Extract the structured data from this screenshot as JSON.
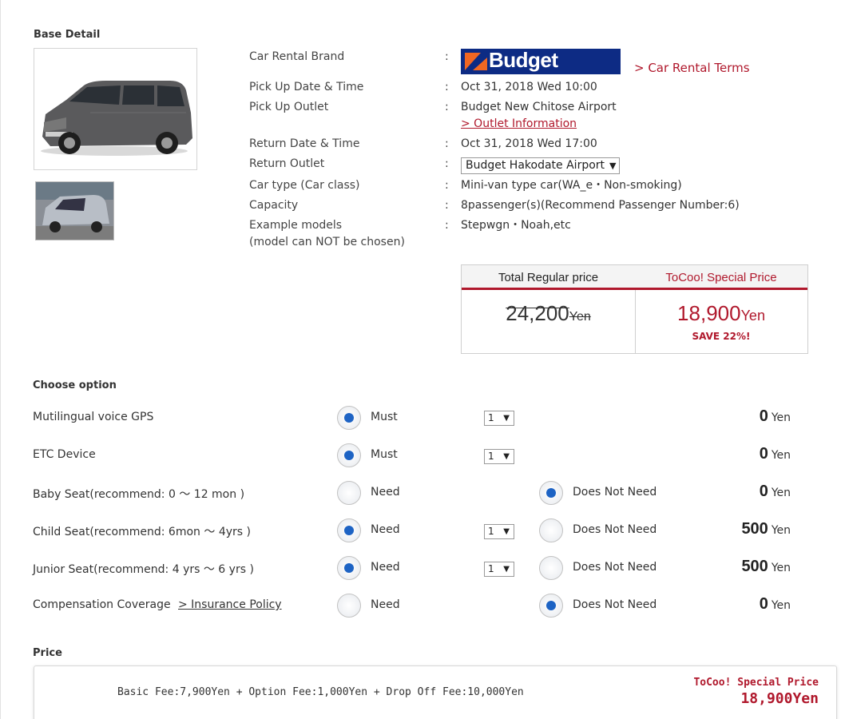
{
  "base_detail": {
    "title": "Base Detail",
    "rows": {
      "brand": {
        "label": "Car Rental Brand",
        "logo_text": "Budget",
        "terms_link": "> Car Rental Terms"
      },
      "pickup_datetime": {
        "label": "Pick Up Date & Time",
        "value": "Oct 31, 2018 Wed 10:00"
      },
      "pickup_outlet": {
        "label": "Pick Up Outlet",
        "value": "Budget New Chitose Airport",
        "link": "> Outlet Information"
      },
      "return_datetime": {
        "label": "Return Date & Time",
        "value": "Oct 31, 2018 Wed 17:00"
      },
      "return_outlet": {
        "label": "Return Outlet",
        "selected": "Budget Hakodate Airport"
      },
      "car_type": {
        "label": "Car type (Car class)",
        "value": "Mini-van type car(WA_e・Non-smoking)"
      },
      "capacity": {
        "label": "Capacity",
        "value": "8passenger(s)(Recommend Passenger Number:6)"
      },
      "example_models": {
        "label": "Example models",
        "label2": "(model can NOT be chosen)",
        "value": "Stepwgn・Noah,etc"
      }
    },
    "colon": ":"
  },
  "price_table": {
    "regular_label": "Total Regular price",
    "regular_value": "24,200",
    "special_label": "ToCoo! Special Price",
    "special_value": "18,900",
    "unit": "Yen",
    "save_text": "SAVE 22%!"
  },
  "options": {
    "title": "Choose option",
    "unit": "Yen",
    "items": [
      {
        "label": "Mutilingual voice GPS",
        "opt1": "Must",
        "qty": "1",
        "price": "0"
      },
      {
        "label": "ETC Device",
        "opt1": "Must",
        "qty": "1",
        "price": "0"
      },
      {
        "label": "Baby Seat(recommend: 0 〜 12 mon )",
        "opt1": "Need",
        "opt2": "Does Not Need",
        "price": "0"
      },
      {
        "label": "Child Seat(recommend: 6mon 〜 4yrs )",
        "opt1": "Need",
        "opt2": "Does Not Need",
        "qty": "1",
        "price": "500"
      },
      {
        "label": "Junior Seat(recommend: 4 yrs 〜 6 yrs )",
        "opt1": "Need",
        "opt2": "Does Not Need",
        "qty": "1",
        "price": "500"
      },
      {
        "label": "Compensation Coverage",
        "link": "> Insurance Policy",
        "opt1": "Need",
        "opt2": "Does Not Need",
        "price": "0"
      }
    ]
  },
  "price_summary": {
    "title": "Price",
    "breakdown": "Basic Fee:7,900Yen + Option Fee:1,000Yen + Drop Off Fee:10,000Yen",
    "special_label": "ToCoo! Special Price",
    "special_value": "18,900Yen"
  },
  "colors": {
    "accent_red": "#b0182c",
    "radio_blue": "#1d63c4",
    "budget_navy": "#0d2b84",
    "budget_orange": "#f26722"
  }
}
